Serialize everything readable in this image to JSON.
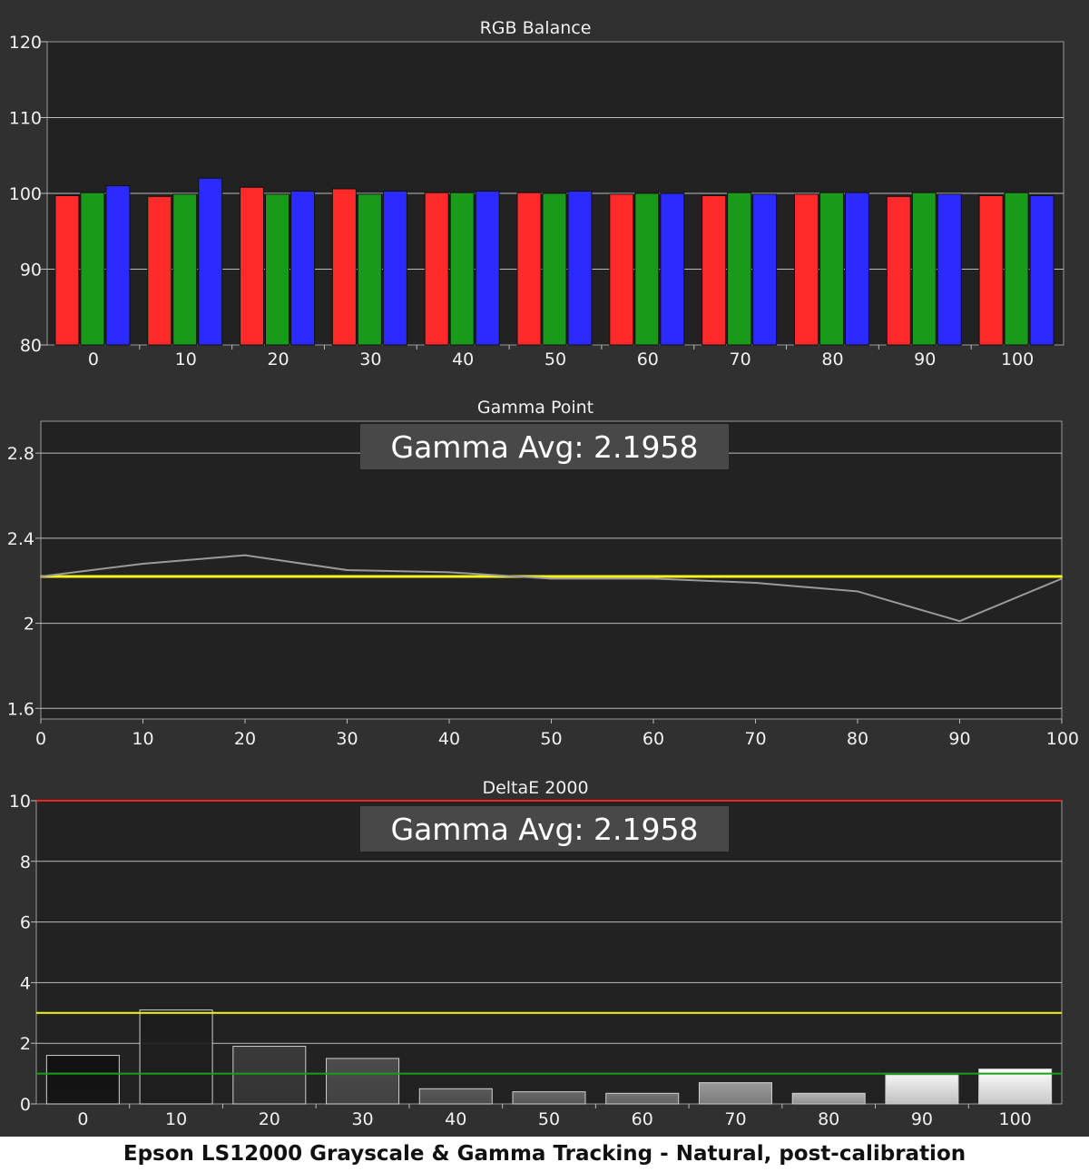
{
  "caption": "Epson LS12000 Grayscale & Gamma Tracking - Natural, post-calibration",
  "colors": {
    "panel_bg": "#303030",
    "plot_bg": "#222222",
    "grid": "#bcbcbc",
    "text": "#f0f0f0",
    "red": "#ff2b2b",
    "green": "#1a9a1a",
    "blue": "#2b2bff",
    "yellow": "#f5f51e",
    "gray_line": "#9a9a9a",
    "limit_red": "#ff2020",
    "limit_green": "#18a018",
    "overlay_bg": "#484848",
    "overlay_text": "#ffffff"
  },
  "chart_data": [
    {
      "type": "bar",
      "title": "RGB Balance",
      "categories": [
        "0",
        "10",
        "20",
        "30",
        "40",
        "50",
        "60",
        "70",
        "80",
        "90",
        "100"
      ],
      "ylim": [
        80,
        120
      ],
      "yticks": [
        "80",
        "90",
        "100",
        "110",
        "120"
      ],
      "grid": true,
      "series": [
        {
          "color": "red",
          "values": [
            99.7,
            99.6,
            100.8,
            100.6,
            100.1,
            100.1,
            99.9,
            99.7,
            99.9,
            99.6,
            99.7
          ]
        },
        {
          "color": "green",
          "values": [
            100.1,
            99.9,
            99.9,
            99.9,
            100.1,
            100.0,
            100.0,
            100.1,
            100.1,
            100.1,
            100.1
          ]
        },
        {
          "color": "blue",
          "values": [
            101.0,
            102.0,
            100.3,
            100.3,
            100.3,
            100.3,
            100.0,
            99.9,
            100.1,
            99.9,
            99.7
          ]
        }
      ]
    },
    {
      "type": "line",
      "title": "Gamma Point",
      "annotation": "Gamma Avg: 2.1958",
      "x": [
        0,
        10,
        20,
        30,
        40,
        50,
        60,
        70,
        80,
        90,
        100
      ],
      "xticks": [
        "0",
        "10",
        "20",
        "30",
        "40",
        "50",
        "60",
        "70",
        "80",
        "90",
        "100"
      ],
      "xlim": [
        0,
        100
      ],
      "ylim": [
        1.55,
        2.95
      ],
      "yticks": [
        "1.6",
        "2",
        "2.4",
        "2.8"
      ],
      "ytick_values": [
        1.6,
        2.0,
        2.4,
        2.8
      ],
      "grid": true,
      "series": [
        {
          "color": "gray_line",
          "values": [
            2.22,
            2.28,
            2.32,
            2.25,
            2.24,
            2.21,
            2.21,
            2.19,
            2.15,
            2.01,
            2.21
          ]
        },
        {
          "color": "yellow",
          "values": [
            2.22,
            2.22,
            2.22,
            2.22,
            2.22,
            2.22,
            2.22,
            2.22,
            2.22,
            2.22,
            2.22
          ]
        }
      ]
    },
    {
      "type": "bar",
      "title": "DeltaE 2000",
      "annotation": "Gamma Avg: 2.1958",
      "categories": [
        "0",
        "10",
        "20",
        "30",
        "40",
        "50",
        "60",
        "70",
        "80",
        "90",
        "100"
      ],
      "ylim": [
        0,
        10
      ],
      "yticks": [
        "0",
        "2",
        "4",
        "6",
        "8",
        "10"
      ],
      "grid": true,
      "values": [
        1.6,
        3.1,
        1.9,
        1.5,
        0.5,
        0.4,
        0.35,
        0.7,
        0.35,
        0.95,
        1.15
      ],
      "bar_colors": [
        "#111111",
        "#1d1d1d",
        "#3a3a3a",
        "#4c4c4c",
        "#5a5a5a",
        "#686868",
        "#767676",
        "#9a9a9a",
        "#b4b4b4",
        "#f4f4f4",
        "#ffffff"
      ],
      "reference_lines": [
        {
          "value": 10,
          "color": "limit_red"
        },
        {
          "value": 3,
          "color": "yellow"
        },
        {
          "value": 1,
          "color": "limit_green"
        }
      ]
    }
  ]
}
